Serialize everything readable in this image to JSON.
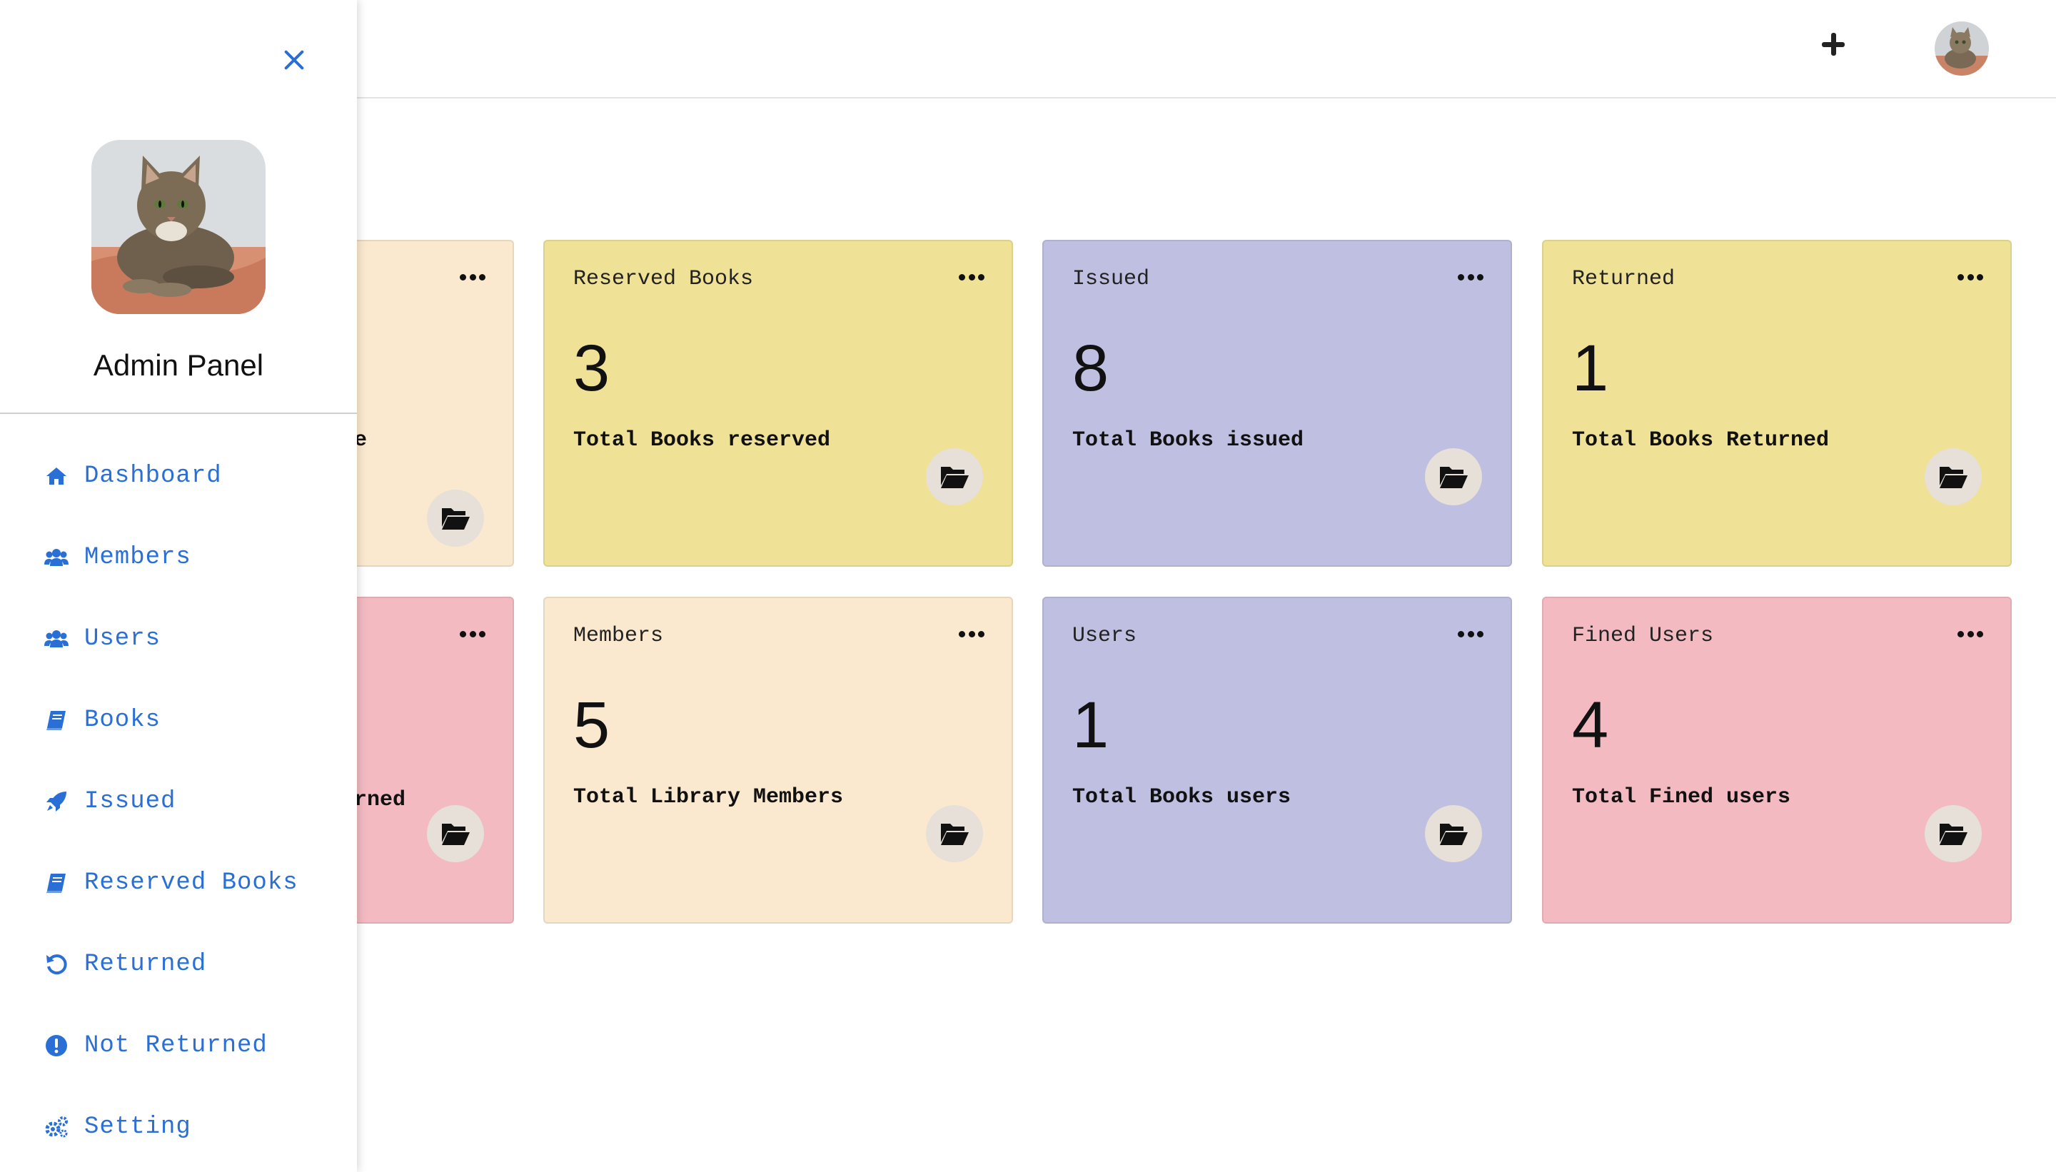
{
  "sidebar": {
    "admin_title": "Admin Panel",
    "nav": [
      {
        "label": "Dashboard",
        "icon": "home-icon"
      },
      {
        "label": "Members",
        "icon": "users-icon"
      },
      {
        "label": "Users",
        "icon": "users-icon"
      },
      {
        "label": "Books",
        "icon": "book-icon"
      },
      {
        "label": "Issued",
        "icon": "rocket-icon"
      },
      {
        "label": "Reserved Books",
        "icon": "book-icon"
      },
      {
        "label": "Returned",
        "icon": "undo-icon"
      },
      {
        "label": "Not Returned",
        "icon": "exclamation-circle-icon"
      },
      {
        "label": "Setting",
        "icon": "cogs-icon"
      }
    ],
    "accent": "#2a6fd6"
  },
  "cards": [
    {
      "title": "",
      "value": "",
      "desc": "",
      "partial_text": "e",
      "color": "#fbe9cf"
    },
    {
      "title": "Reserved Books",
      "value": "3",
      "desc": "Total Books reserved",
      "color": "#efe297"
    },
    {
      "title": "Issued",
      "value": "8",
      "desc": "Total Books issued",
      "color": "#bfbfe1"
    },
    {
      "title": "Returned",
      "value": "1",
      "desc": "Total Books Returned",
      "color": "#efe297"
    },
    {
      "title": "",
      "value": "",
      "desc": "",
      "partial_text": "rned",
      "color": "#f3bac2"
    },
    {
      "title": "Members",
      "value": "5",
      "desc": "Total Library Members",
      "color": "#fbe9cf"
    },
    {
      "title": "Users",
      "value": "1",
      "desc": "Total Books users",
      "color": "#bfbfe1"
    },
    {
      "title": "Fined Users",
      "value": "4",
      "desc": "Total Fined users",
      "color": "#f3bac2"
    }
  ]
}
